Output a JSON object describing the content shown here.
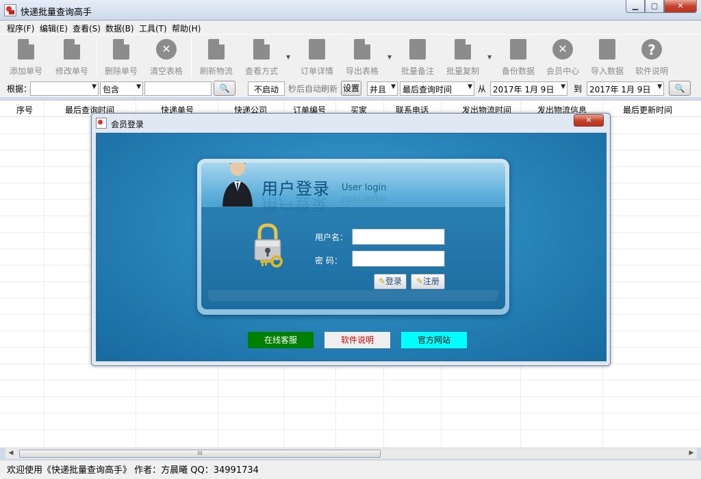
{
  "window": {
    "title": "快递批量查询高手",
    "minimize": "▁",
    "maximize": "▢",
    "close": "✕"
  },
  "menu": [
    "程序(F)",
    "编辑(E)",
    "查看(S)",
    "数据(B)",
    "工具(T)",
    "帮助(H)"
  ],
  "toolbar": [
    {
      "label": "添加单号",
      "icon": "add-doc-icon"
    },
    {
      "label": "修改单号",
      "icon": "edit-doc-icon"
    },
    {
      "label": "删除单号",
      "icon": "delete-doc-icon"
    },
    {
      "label": "清空表格",
      "icon": "clear-icon"
    },
    {
      "label": "刷新物流",
      "icon": "refresh-doc-icon"
    },
    {
      "label": "查看方式",
      "icon": "view-doc-icon"
    },
    {
      "label": "订单详情",
      "icon": "order-detail-icon"
    },
    {
      "label": "导出表格",
      "icon": "export-icon"
    },
    {
      "label": "批量备注",
      "icon": "batch-note-icon"
    },
    {
      "label": "批量复制",
      "icon": "batch-copy-icon"
    },
    {
      "label": "备份数据",
      "icon": "backup-icon"
    },
    {
      "label": "会员中心",
      "icon": "clock-icon"
    },
    {
      "label": "导入数据",
      "icon": "import-icon"
    },
    {
      "label": "软件说明",
      "icon": "help-icon"
    }
  ],
  "filter": {
    "by_label": "根据：",
    "field_value": "",
    "match_value": "包含",
    "search_text": "",
    "auto_status": "不启动",
    "auto_refresh_label": "秒后自动刷新",
    "settings_button": "设置",
    "logic_value": "并且",
    "date_field": "最后查询时间",
    "from_label": "从",
    "from_date": "2017年  1月  9日",
    "to_label": "到",
    "to_date": "2017年  1月  9日"
  },
  "grid": {
    "columns": [
      "序号",
      "最后查询时间",
      "快递单号",
      "快递公司",
      "订单编号",
      "买家",
      "联系电话",
      "发出物流时间",
      "发出物流信息",
      "最后更新时间"
    ]
  },
  "status": {
    "text": "欢迎使用《快递批量查询高手》 作者：方晨曦  QQ：34991734"
  },
  "scroll": {
    "grip": "III"
  },
  "dialog": {
    "title": "会员登录",
    "close": "✕",
    "panel_title": "用户登录",
    "panel_subtitle": "User login",
    "username_label": "用户名：",
    "password_label": "密  码：",
    "username_value": "",
    "password_value": "",
    "login_button": "登录",
    "register_button": "注册",
    "links": [
      {
        "label": "在线客服",
        "bg": "#008000",
        "fg": "#ffffff"
      },
      {
        "label": "软件说明",
        "bg": "#f0f0f0",
        "fg": "#e00000"
      },
      {
        "label": "官方网站",
        "bg": "#00ffff",
        "fg": "#000000"
      }
    ]
  }
}
